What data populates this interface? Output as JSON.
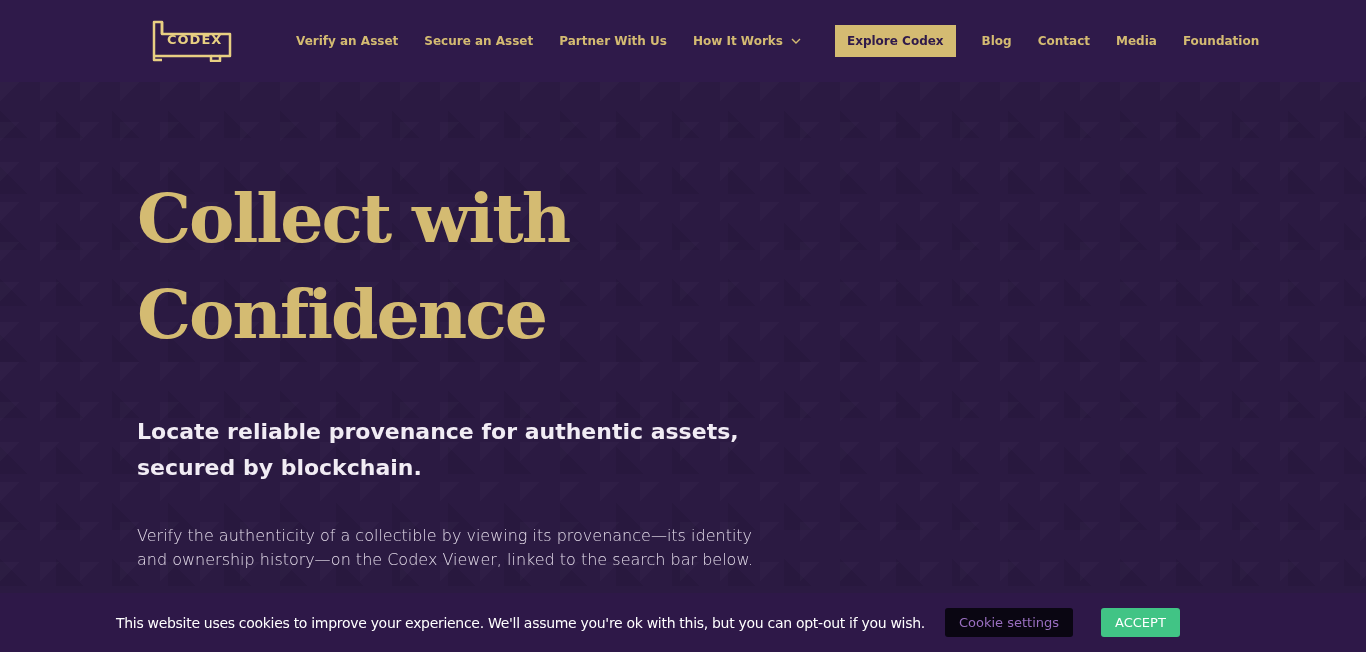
{
  "header": {
    "logo": "CODEX",
    "nav": [
      {
        "label": "Verify an Asset",
        "kind": "link"
      },
      {
        "label": "Secure an Asset",
        "kind": "link"
      },
      {
        "label": "Partner With Us",
        "kind": "link"
      },
      {
        "label": "How It Works",
        "kind": "dropdown"
      },
      {
        "label": "Explore Codex",
        "kind": "button"
      },
      {
        "label": "Blog",
        "kind": "link"
      },
      {
        "label": "Contact",
        "kind": "link"
      },
      {
        "label": "Media",
        "kind": "link"
      },
      {
        "label": "Foundation",
        "kind": "link"
      }
    ]
  },
  "hero": {
    "title_lines": [
      "Collect with",
      "Confidence"
    ],
    "subtitle": "Locate reliable provenance for authentic assets, secured by blockchain.",
    "body": "Verify the authenticity of a collectible by viewing its provenance—its identity and ownership history—on the Codex Viewer, linked to the search bar below."
  },
  "cookie_bar": {
    "message": "This website uses cookies to improve your experience. We'll assume you're ok with this, but you can opt-out if you wish.",
    "settings_button": "Cookie settings",
    "accept_button": "ACCEPT"
  }
}
